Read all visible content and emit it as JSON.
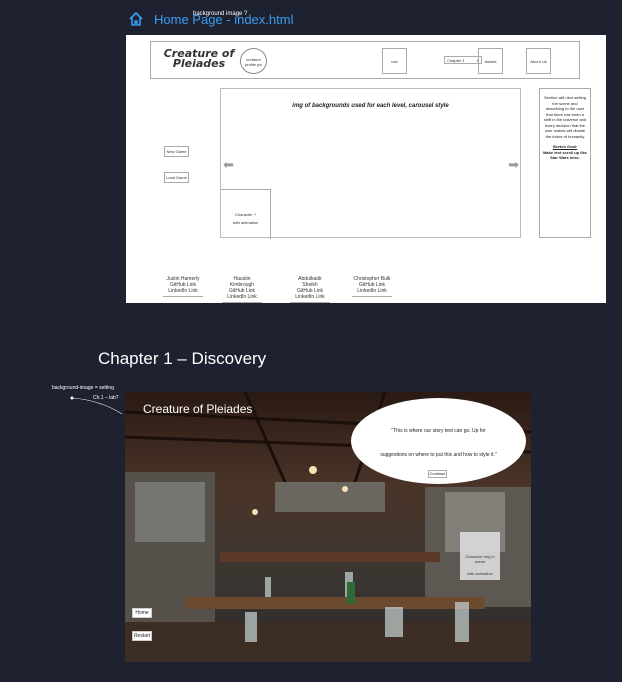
{
  "frame1": {
    "title": "Home Page - index.html",
    "note": "background image ?"
  },
  "wireframe": {
    "logo_line1": "Creature of",
    "logo_line2": "Pleiades",
    "avatar_text": "creature profile pic",
    "nav": [
      "nav",
      "Assets",
      "About Us"
    ],
    "chapter_select": "Chapter 1",
    "carousel_caption": "img of backgrounds used for each level, carousel style",
    "character_box": "Character ?",
    "character_sub": "with animation",
    "side_text": "Section with text setting the scene and describing to the user that there has been a shift in the universe and every decision that the user makes will dictate the future of humanity",
    "side_link": "Sketch Goal:",
    "side_bold": "Make text scroll up like Star Wars intro.",
    "new_game": "New Game",
    "load_game": "Load Game",
    "credits": [
      {
        "name": "Justin Hamerly",
        "gh": "GitHub Link",
        "li": "LinkedIn Link"
      },
      {
        "name": "Haustin Kimbrough",
        "gh": "GitHub Link",
        "li": "LinkedIn Link"
      },
      {
        "name": "Abdulkadir Sheikh",
        "gh": "GitHub Link",
        "li": "LinkedIn Link"
      },
      {
        "name": "Christopher Bulk",
        "gh": "GitHub Link",
        "li": "LinkedIn Link"
      }
    ]
  },
  "chapter": {
    "title": "Chapter 1 – Discovery",
    "note1": "background-image = setting",
    "note2": "Ch.1 – lab?"
  },
  "scene": {
    "title": "Creature of Pleiades",
    "story_line1": "\"This is where our story text can go. Up for",
    "story_line2": "suggestions on where to put this and how to style it.\"",
    "continue": "Continue",
    "character": "Character img in scene",
    "character_sub": "with animation",
    "home": "Home",
    "restart": "Restart"
  },
  "colors": {
    "background": "#1e2230",
    "link_blue": "#3a9df0"
  }
}
